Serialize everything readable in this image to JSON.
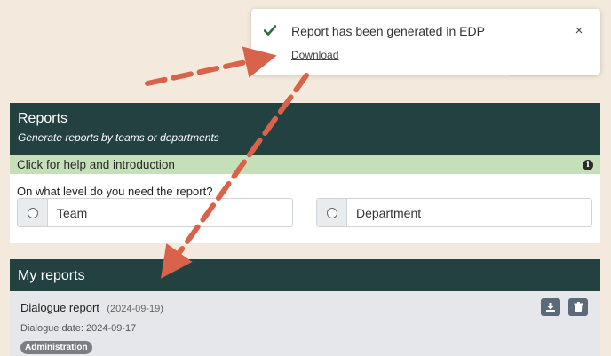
{
  "toast": {
    "message": "Report has been generated in EDP",
    "link": "Download",
    "close": "×",
    "check_icon": "check-icon",
    "accent": "#2e7d32"
  },
  "reports": {
    "title": "Reports",
    "subtitle": "Generate reports by teams or departments",
    "help": "Click for help and introduction",
    "question": "On what level do you need the report?",
    "options": [
      "Team",
      "Department"
    ],
    "header_color": "#234141",
    "help_color": "#c5dfb9"
  },
  "my_reports": {
    "title": "My reports",
    "items": [
      {
        "title": "Dialogue report",
        "date": "(2024-09-19)",
        "dialogue_date": "Dialogue date: 2024-09-17",
        "tag": "Administration"
      }
    ]
  },
  "annotation": {
    "arrow_color": "#d9634a"
  }
}
